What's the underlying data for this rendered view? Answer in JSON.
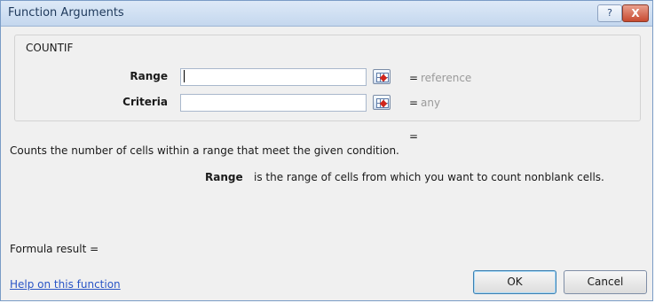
{
  "window": {
    "title": "Function Arguments",
    "help_label": "?",
    "close_label": "X"
  },
  "function": {
    "name": "COUNTIF"
  },
  "arguments": [
    {
      "label": "Range",
      "value": "",
      "equals": "=",
      "hint": "reference"
    },
    {
      "label": "Criteria",
      "value": "",
      "equals": "=",
      "hint": "any"
    }
  ],
  "result_equals": "=",
  "description": "Counts the number of cells within a range that meet the given condition.",
  "arg_help": {
    "name": "Range",
    "text": "is the range of cells from which you want to count nonblank cells."
  },
  "formula_result_label": "Formula result =",
  "help_link": "Help on this function",
  "buttons": {
    "ok": "OK",
    "cancel": "Cancel"
  }
}
